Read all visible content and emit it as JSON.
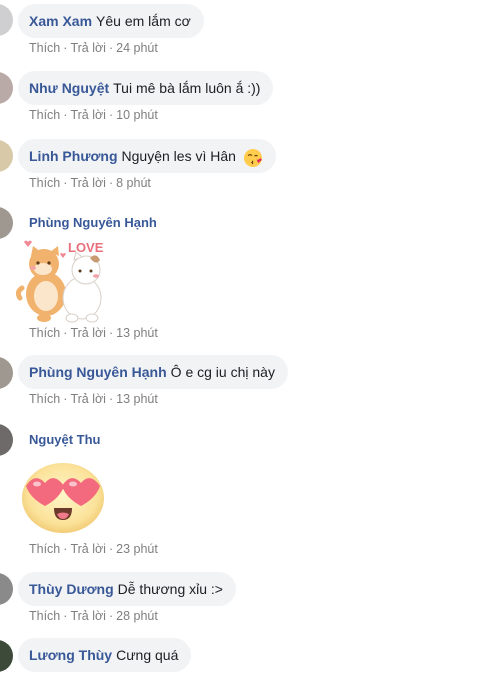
{
  "actions": {
    "like": "Thích",
    "reply": "Trả lời",
    "separator": "·"
  },
  "comments": [
    {
      "name": "Xam Xam",
      "text": "Yêu em lắm cơ",
      "time": "24 phút"
    },
    {
      "name": "Như Nguyệt",
      "text": "Tui mê bà lắm luôn ắ :))",
      "time": "10 phút"
    },
    {
      "name": "Linh Phương",
      "text": "Nguyện les vì Hân",
      "time": "8 phút",
      "emoji": "kissing-heart-emoji"
    },
    {
      "name": "Phùng Nguyên Hạnh",
      "sticker": "love-cats-sticker",
      "sticker_text": "LOVE",
      "time": "13 phút"
    },
    {
      "name": "Phùng Nguyên Hạnh",
      "text": "Ô e cg iu chị này",
      "time": "13 phút"
    },
    {
      "name": "Nguyệt Thu",
      "sticker": "heart-eyes-emoji-sticker",
      "time": "23 phút"
    },
    {
      "name": "Thùy Dương",
      "text": "Dễ thương xỉu :>",
      "time": "28 phút"
    },
    {
      "name": "Lương Thùy",
      "text": "Cưng quá"
    }
  ],
  "colors": {
    "name": "#385898",
    "bubble": "#f2f3f5",
    "meta": "#7f7f7f"
  }
}
